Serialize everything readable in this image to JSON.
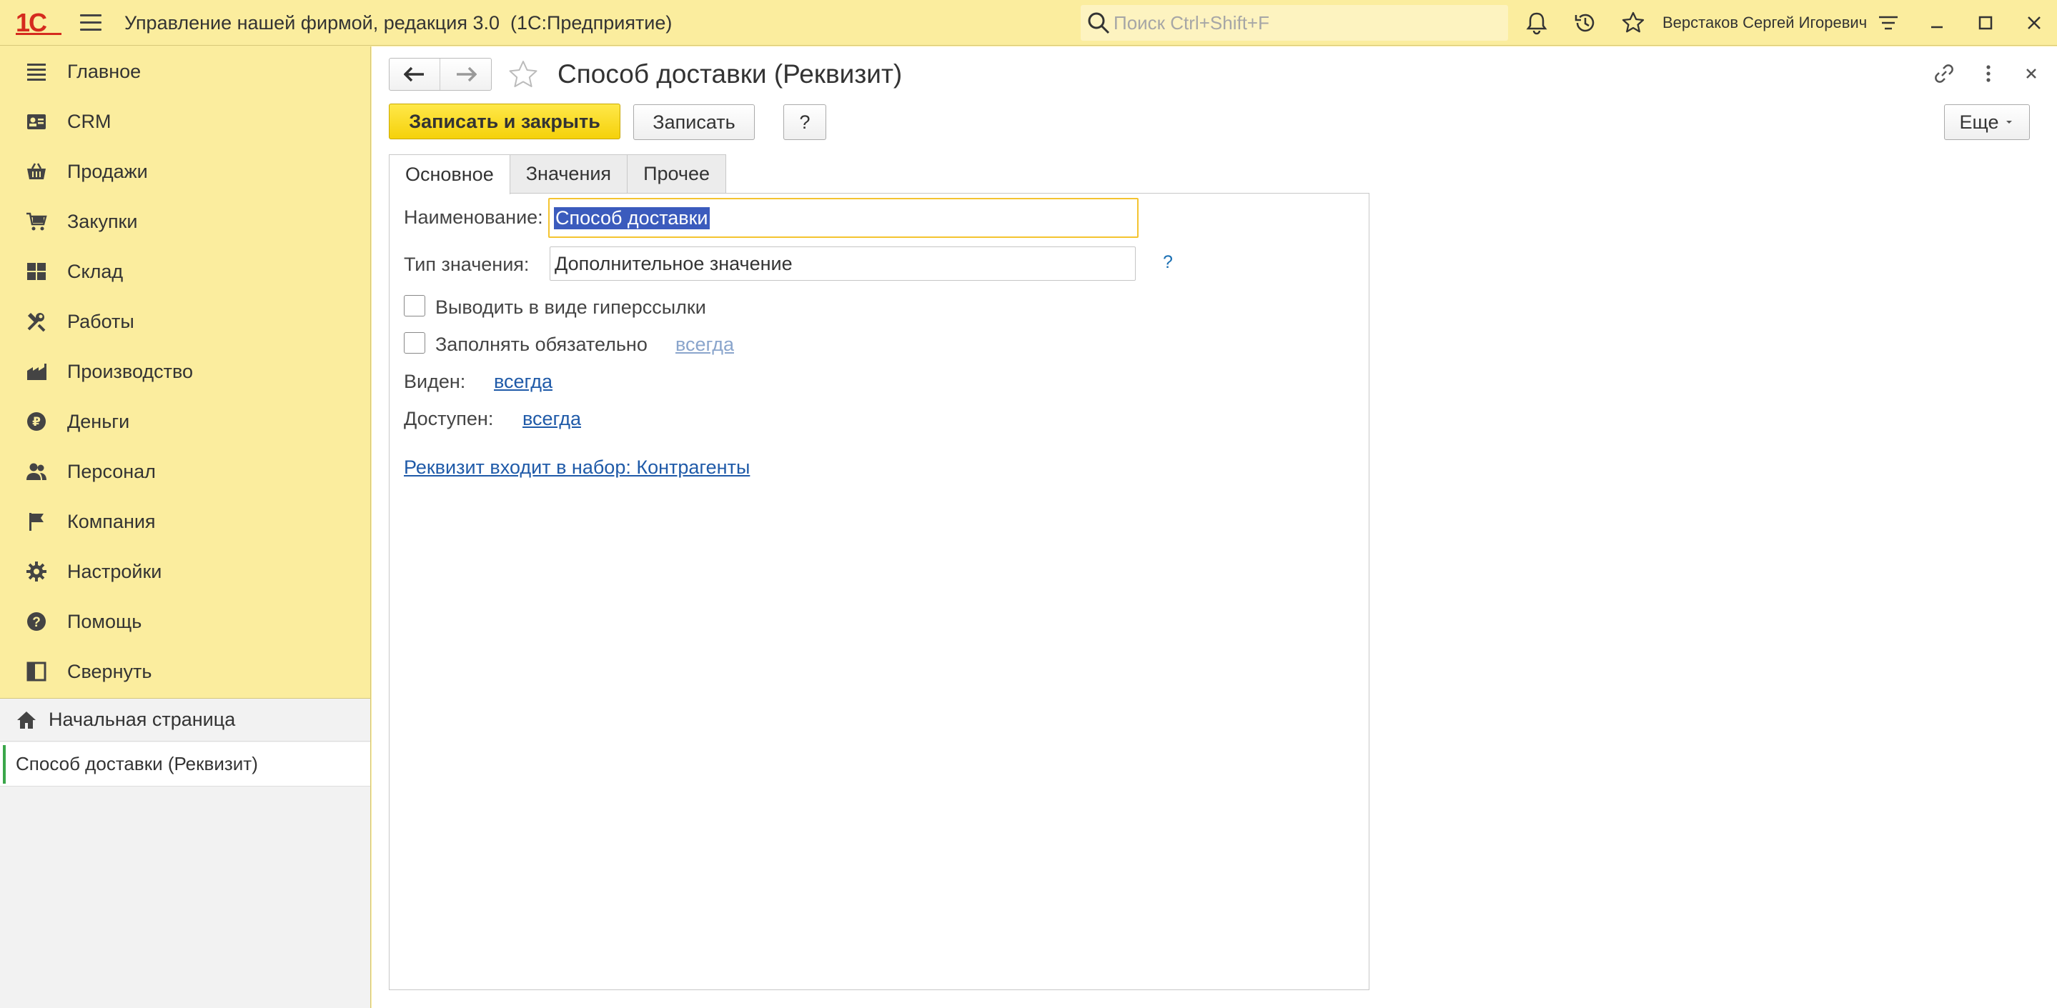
{
  "app": {
    "title": "Управление нашей фирмой, редакция 3.0  (1С:Предприятие)",
    "logo_text": "1С",
    "search_placeholder": "Поиск Ctrl+Shift+F",
    "user_name": "Верстаков Сергей Игоревич"
  },
  "sidebar": {
    "items": [
      {
        "label": "Главное",
        "icon": "list-icon"
      },
      {
        "label": "CRM",
        "icon": "contact-card-icon"
      },
      {
        "label": "Продажи",
        "icon": "shopping-basket-icon"
      },
      {
        "label": "Закупки",
        "icon": "shopping-cart-icon"
      },
      {
        "label": "Склад",
        "icon": "warehouse-grid-icon"
      },
      {
        "label": "Работы",
        "icon": "tools-icon"
      },
      {
        "label": "Производство",
        "icon": "factory-icon"
      },
      {
        "label": "Деньги",
        "icon": "ruble-coin-icon"
      },
      {
        "label": "Персонал",
        "icon": "people-icon"
      },
      {
        "label": "Компания",
        "icon": "flag-icon"
      },
      {
        "label": "Настройки",
        "icon": "gear-icon"
      },
      {
        "label": "Помощь",
        "icon": "help-circle-icon"
      },
      {
        "label": "Свернуть",
        "icon": "collapse-panel-icon"
      }
    ],
    "home_label": "Начальная страница",
    "open_window_label": "Способ доставки (Реквизит)"
  },
  "form": {
    "title": "Способ доставки (Реквизит)",
    "btn_save_close": "Записать и закрыть",
    "btn_save": "Записать",
    "btn_help": "?",
    "btn_more": "Еще",
    "tabs": [
      "Основное",
      "Значения",
      "Прочее"
    ],
    "name_label": "Наименование:",
    "name_value": "Способ доставки",
    "type_label": "Тип значения:",
    "type_value": "Дополнительное значение",
    "type_help": "?",
    "hyperlink_label": "Выводить в виде гиперссылки",
    "required_label": "Заполнять обязательно",
    "required_link": "всегда",
    "visible_label": "Виден:",
    "visible_link": "всегда",
    "available_label": "Доступен:",
    "available_link": "всегда",
    "set_link": "Реквизит входит в набор: Контрагенты"
  },
  "colors": {
    "panel_bg": "#fbed9e",
    "primary_button": "#f5d10a",
    "link": "#1f5aa8",
    "selection": "#3b5bbd",
    "accent_green": "#3aa64a",
    "logo_red": "#d52b1e"
  }
}
